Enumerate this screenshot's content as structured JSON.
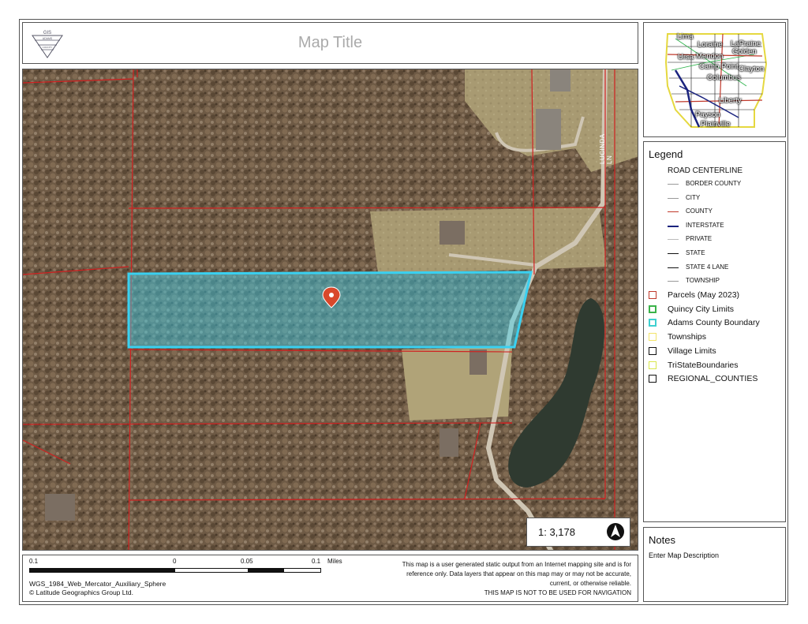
{
  "map_title": "Map Title",
  "logo": {
    "top": "GIS",
    "mid": "ADAMS",
    "bottom": "COUNTY"
  },
  "road_label": "LUCINDA LN",
  "scale_text": "1: 3,178",
  "overview_labels": [
    "Lima",
    "Loraine",
    "LaPraine",
    "Ursa",
    "Mendon",
    "Golden",
    "Camp Point",
    "Clayton",
    "Columbus",
    "Liberty",
    "Payson",
    "Plainville"
  ],
  "legend": {
    "title": "Legend",
    "group": "ROAD CENTERLINE",
    "lines": [
      {
        "label": "BORDER COUNTY",
        "color": "#999999"
      },
      {
        "label": "CITY",
        "color": "#999999"
      },
      {
        "label": "COUNTY",
        "color": "#c0392b"
      },
      {
        "label": "INTERSTATE",
        "color": "#1a237e"
      },
      {
        "label": "PRIVATE",
        "color": "#bbbbbb"
      },
      {
        "label": "STATE",
        "color": "#111111"
      },
      {
        "label": "STATE 4 LANE",
        "color": "#111111"
      },
      {
        "label": "TOWNSHIP",
        "color": "#999999"
      }
    ],
    "polygons": [
      {
        "label": "Parcels (May 2023)",
        "color": "#c0392b"
      },
      {
        "label": "Quincy City Limits",
        "color": "#3bb34a"
      },
      {
        "label": "Adams County Boundary",
        "color": "#3fd0d0"
      },
      {
        "label": "Townships",
        "color": "#f3e46b"
      },
      {
        "label": "Village Limits",
        "color": "#111111"
      },
      {
        "label": "TriStateBoundaries",
        "color": "#d9e84c"
      },
      {
        "label": "REGIONAL_COUNTIES",
        "color": "#111111"
      }
    ]
  },
  "notes": {
    "title": "Notes",
    "description": "Enter Map Description"
  },
  "scalebar": {
    "ticks": [
      "0.1",
      "0",
      "0.05",
      "0.1"
    ],
    "unit": "Miles"
  },
  "crs": "WGS_1984_Web_Mercator_Auxiliary_Sphere",
  "copyright": "© Latitude Geographics Group Ltd.",
  "disclaimer": "This map is a user generated static output from an Internet mapping site and is for reference only. Data layers that appear on this map may or may not be accurate, current, or otherwise reliable.",
  "disclaimer_warning": "THIS MAP IS NOT TO BE USED FOR NAVIGATION",
  "colors": {
    "parcel_line": "#d02020",
    "highlight": "#3ad0f0",
    "marker": "#d9482b"
  }
}
